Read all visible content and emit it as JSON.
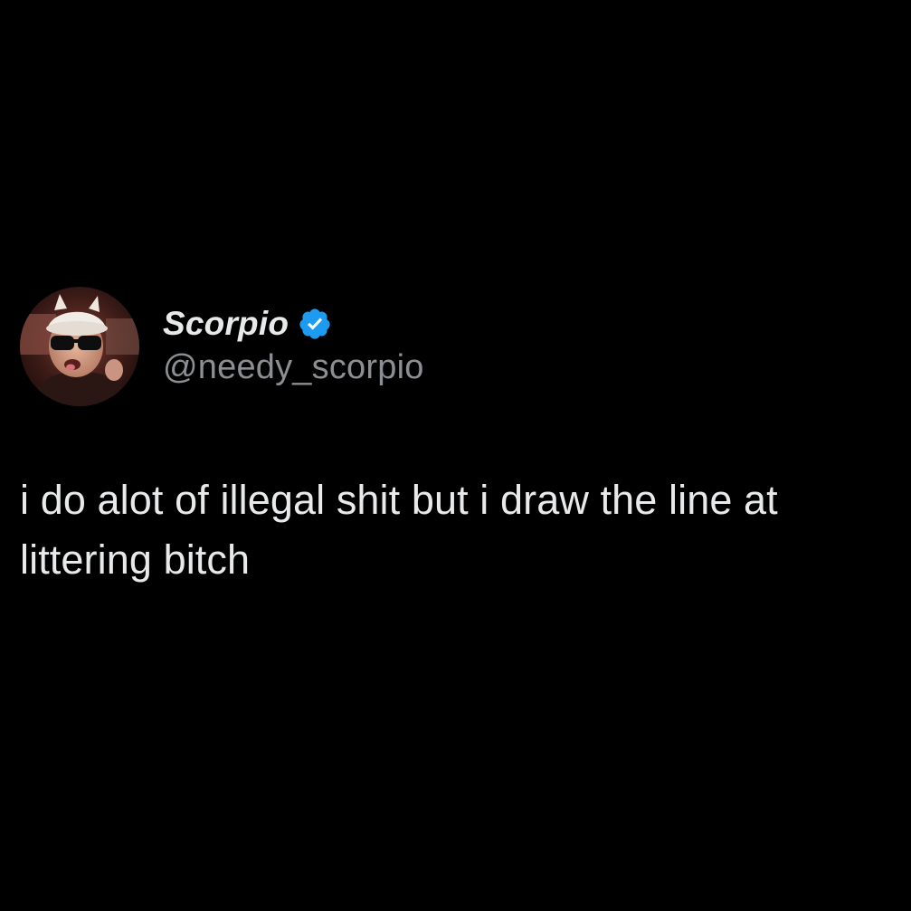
{
  "tweet": {
    "author": {
      "display_name": "Scorpio",
      "handle": "@needy_scorpio",
      "verified": true,
      "verified_color": "#1d9bf0"
    },
    "text": "i do alot of illegal shit but i draw the line at littering bitch"
  },
  "colors": {
    "background": "#000000",
    "primary_text": "#e7e9ea",
    "secondary_text": "#8b8f94"
  }
}
